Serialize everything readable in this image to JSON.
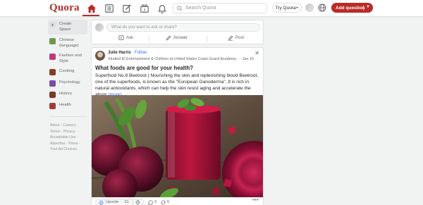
{
  "header": {
    "logo": "Quora",
    "search_placeholder": "Search Quora",
    "try_button": "Try Quora+",
    "add_question": "Add question",
    "colors": {
      "brand": "#b92b27",
      "link": "#2e69ff"
    }
  },
  "sidebar": {
    "create_space_line1": "Create",
    "create_space_line2": "Space",
    "items": [
      {
        "label_line1": "Chinese",
        "label_line2": "(language)",
        "color": "#6f9a4e"
      },
      {
        "label_line1": "Fashion and",
        "label_line2": "Style",
        "color": "#c0397a"
      },
      {
        "label_line1": "Cooking",
        "label_line2": "",
        "color": "#8b3b2b"
      },
      {
        "label_line1": "Psychology",
        "label_line2": "",
        "color": "#7a4aa8"
      },
      {
        "label_line1": "History",
        "label_line2": "",
        "color": "#7a3a28"
      },
      {
        "label_line1": "Health",
        "label_line2": "",
        "color": "#a23a3a"
      }
    ],
    "footer": {
      "line1": "About · Careers ·",
      "line2": "Terms · Privacy ·",
      "line3": "Acceptable Use ·",
      "line4": "Advertise · Press ·",
      "line5": "Your Ad Choices"
    }
  },
  "ask_box": {
    "placeholder": "What do you want to ask or share?",
    "ask_label": "Ask",
    "answer_label": "Answer",
    "post_label": "Post"
  },
  "post": {
    "author": "Julie Harris",
    "follow": "· Follow",
    "credential": "Studied El Entertainment & Children at United States Coast Guard Academy... · Jan 16",
    "question": "What foods are good for your health?",
    "body": "Superfood No.8 Beetroot | Nourishing the skin and replenishing blood Beetroot, one of the superfoods, is known as the \"European Ganoderma\". It is rich in natural antioxidants, which can help the skin resist aging and accelerate the absor",
    "more": "(more)",
    "upvote_label": "Upvote",
    "upvote_count": "31",
    "comments": "3",
    "shares": "5"
  }
}
